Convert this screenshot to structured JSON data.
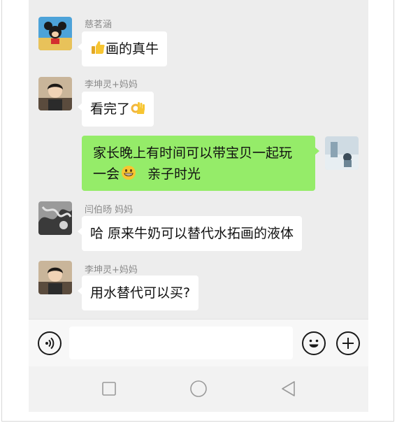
{
  "messages": [
    {
      "sender": "慈茗涵",
      "text": "画的真牛",
      "emoji": "thumbs-up-emoji"
    },
    {
      "sender": "李坤灵+妈妈",
      "text": "看完了",
      "emoji": "ok-hand-emoji"
    },
    {
      "sender": "",
      "line1": "家长晚上有时间可以带宝贝一起玩",
      "line2_a": "一会",
      "line2_b": "亲子时光",
      "emoji": "grinning-face-emoji",
      "mine": true
    },
    {
      "sender": "闫伯旸 妈妈",
      "text": "哈 原来牛奶可以替代水拓画的液体"
    },
    {
      "sender": "李坤灵+妈妈",
      "text": "用水替代可以买?"
    }
  ],
  "input_bar": {
    "voice_icon": "voice-icon",
    "emoji_icon": "emoji-icon",
    "plus_icon": "plus-icon",
    "placeholder": ""
  },
  "nav_bar": {
    "icons": [
      "recent-apps-icon",
      "home-icon",
      "back-icon"
    ]
  },
  "colors": {
    "chat_background": "#ededed",
    "my_bubble": "#95ec69",
    "other_bubble": "#ffffff"
  }
}
